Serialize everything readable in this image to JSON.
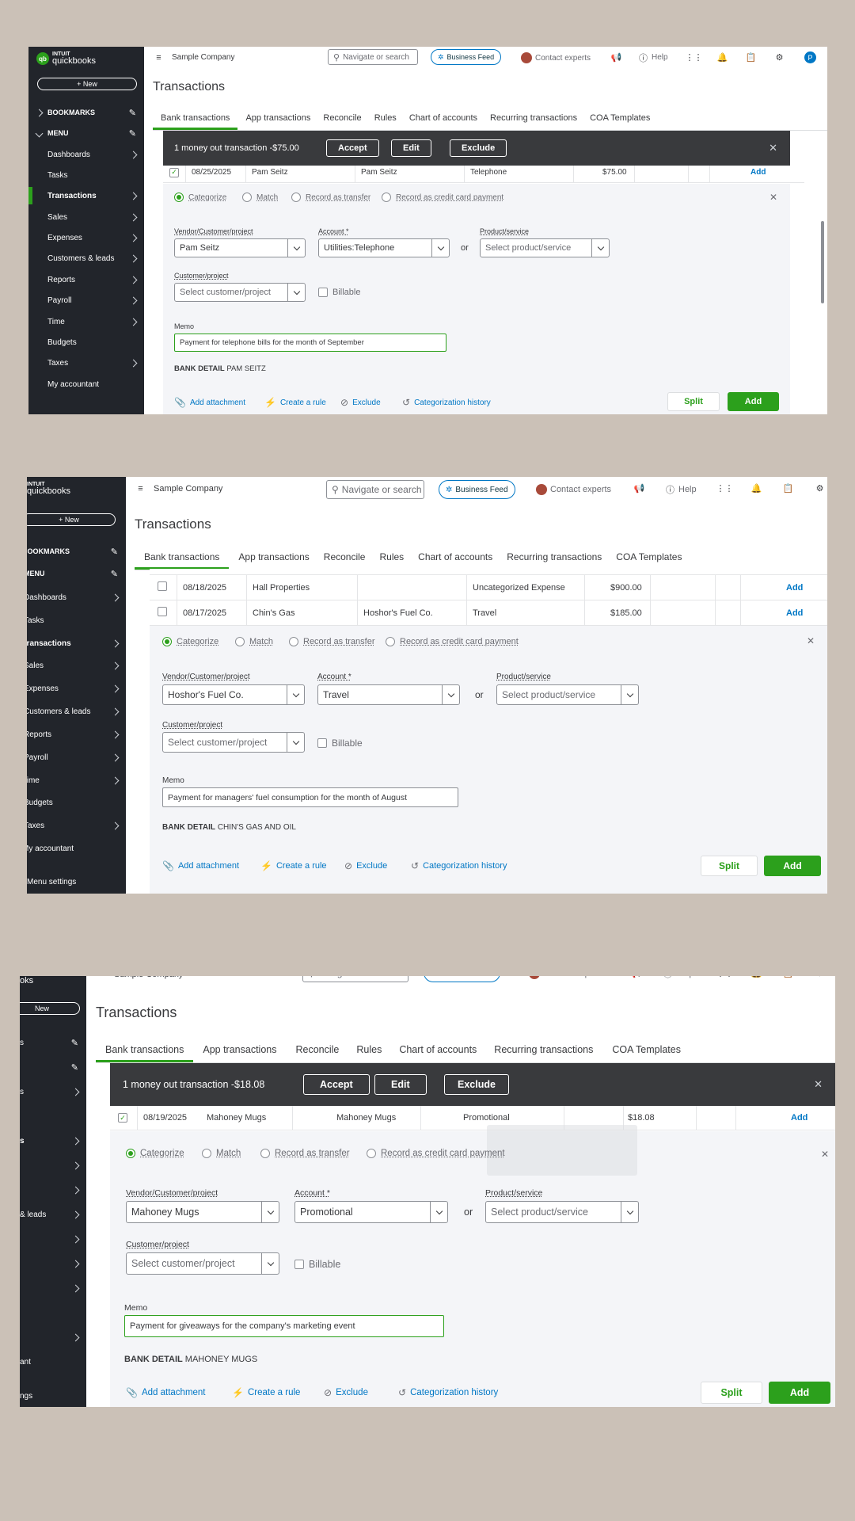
{
  "sidebar": {
    "logo_top": "INTUIT",
    "logo_bottom": "quickbooks",
    "new_label": "+ New",
    "bookmarks_label": "BOOKMARKS",
    "menu_label": "MENU",
    "items": [
      "Dashboards",
      "Tasks",
      "Transactions",
      "Sales",
      "Expenses",
      "Customers & leads",
      "Reports",
      "Payroll",
      "Time",
      "Budgets",
      "Taxes",
      "My accountant"
    ],
    "menu_settings": "Menu settings",
    "s3_logo": "oks",
    "s3_new": "New",
    "s3_items": [
      "s",
      "s",
      "s",
      "& leads",
      "ant",
      "ngs"
    ]
  },
  "topbar": {
    "company": "Sample Company",
    "search_placeholder": "Navigate or search",
    "business_feed": "Business Feed",
    "contact_experts": "Contact experts",
    "help": "Help",
    "avatar_letter": "P"
  },
  "page": {
    "title": "Transactions",
    "tabs": [
      "Bank transactions",
      "App transactions",
      "Reconcile",
      "Rules",
      "Chart of accounts",
      "Recurring transactions",
      "COA Templates"
    ]
  },
  "form": {
    "radios": [
      "Categorize",
      "Match",
      "Record as transfer",
      "Record as credit card payment"
    ],
    "vendor_label": "Vendor/Customer/project",
    "account_label": "Account *",
    "product_label": "Product/service",
    "product_placeholder": "Select product/service",
    "customer_label": "Customer/project",
    "customer_placeholder": "Select customer/project",
    "billable": "Billable",
    "or": "or",
    "memo_label": "Memo",
    "bank_detail_label": "BANK DETAIL",
    "add_attachment": "Add attachment",
    "create_rule": "Create a rule",
    "exclude": "Exclude",
    "categorization_history": "Categorization history",
    "split": "Split",
    "add": "Add",
    "row_add": "Add"
  },
  "banner": {
    "accept": "Accept",
    "edit": "Edit",
    "exclude": "Exclude"
  },
  "shot1": {
    "banner_text": "1 money out transaction -$75.00",
    "row": {
      "date": "08/25/2025",
      "payee": "Pam Seitz",
      "vendor": "Pam Seitz",
      "category": "Telephone",
      "amount": "$75.00"
    },
    "vendor": "Pam Seitz",
    "account": "Utilities:Telephone",
    "memo": "Payment for telephone bills for the month of September",
    "bank_detail": "PAM SEITZ"
  },
  "shot2": {
    "rows": [
      {
        "date": "08/18/2025",
        "payee": "Hall Properties",
        "vendor": "",
        "category": "Uncategorized Expense",
        "amount": "$900.00"
      },
      {
        "date": "08/17/2025",
        "payee": "Chin's Gas",
        "vendor": "Hoshor's Fuel Co.",
        "category": "Travel",
        "amount": "$185.00"
      }
    ],
    "vendor": "Hoshor's Fuel Co.",
    "account": "Travel",
    "memo": "Payment for managers' fuel consumption for the month of August",
    "bank_detail": "CHIN'S GAS AND OIL"
  },
  "shot3": {
    "banner_text": "1 money out transaction -$18.08",
    "row": {
      "date": "08/19/2025",
      "payee": "Mahoney Mugs",
      "vendor": "Mahoney Mugs",
      "category": "Promotional",
      "amount": "$18.08"
    },
    "vendor": "Mahoney Mugs",
    "account": "Promotional",
    "memo": "Payment for giveaways for the company's marketing event",
    "bank_detail": "MAHONEY MUGS"
  },
  "colors": {
    "accent_green": "#2ca01c",
    "link_blue": "#0077c5",
    "sidebar": "#22252b",
    "banner": "#393a3d",
    "background": "#cbc1b7"
  }
}
